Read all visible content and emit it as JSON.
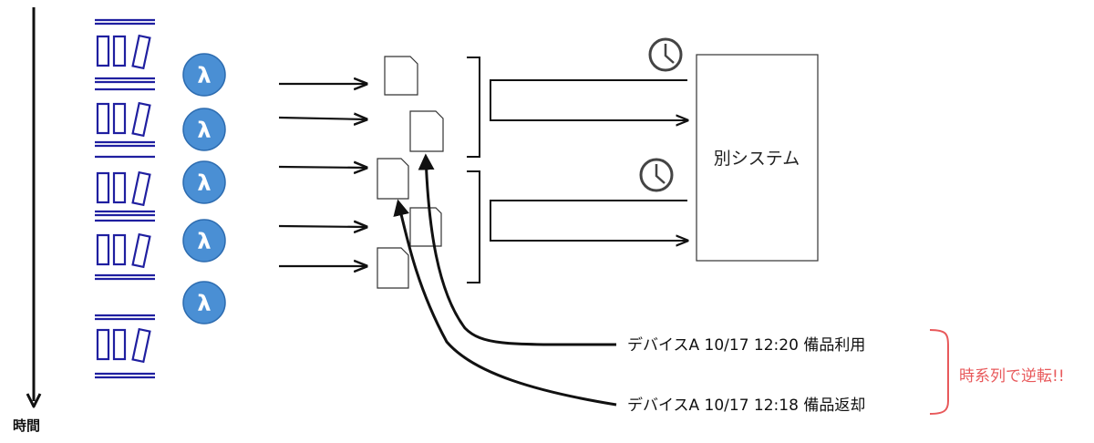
{
  "time_axis": {
    "label": "時間"
  },
  "lambda_icons": [
    {
      "glyph": "λ"
    },
    {
      "glyph": "λ"
    },
    {
      "glyph": "λ"
    },
    {
      "glyph": "λ"
    },
    {
      "glyph": "λ"
    }
  ],
  "system": {
    "label": "別システム"
  },
  "annotations": [
    {
      "text": "デバイスA 10/17 12:20 備品利用"
    },
    {
      "text": "デバイスA 10/17 12:18 備品返却"
    }
  ],
  "reversal_note": "時系列で逆転!!",
  "colors": {
    "queue": "#1f1fa0",
    "lambda": "#4a8fd4",
    "alert": "#e8595b",
    "stroke": "#111111"
  }
}
